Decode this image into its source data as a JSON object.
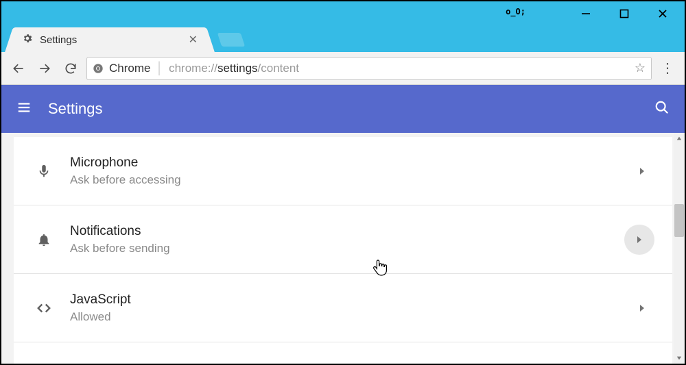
{
  "titlebar": {
    "eyes": "o_O;"
  },
  "tab": {
    "title": "Settings"
  },
  "toolbar": {
    "chrome_label": "Chrome",
    "url_prefix": "chrome://",
    "url_host": "settings",
    "url_path": "/content"
  },
  "appbar": {
    "title": "Settings"
  },
  "rows": [
    {
      "title": "Microphone",
      "sub": "Ask before accessing",
      "icon": "mic",
      "highlight": false
    },
    {
      "title": "Notifications",
      "sub": "Ask before sending",
      "icon": "bell",
      "highlight": true
    },
    {
      "title": "JavaScript",
      "sub": "Allowed",
      "icon": "code",
      "highlight": false
    }
  ]
}
